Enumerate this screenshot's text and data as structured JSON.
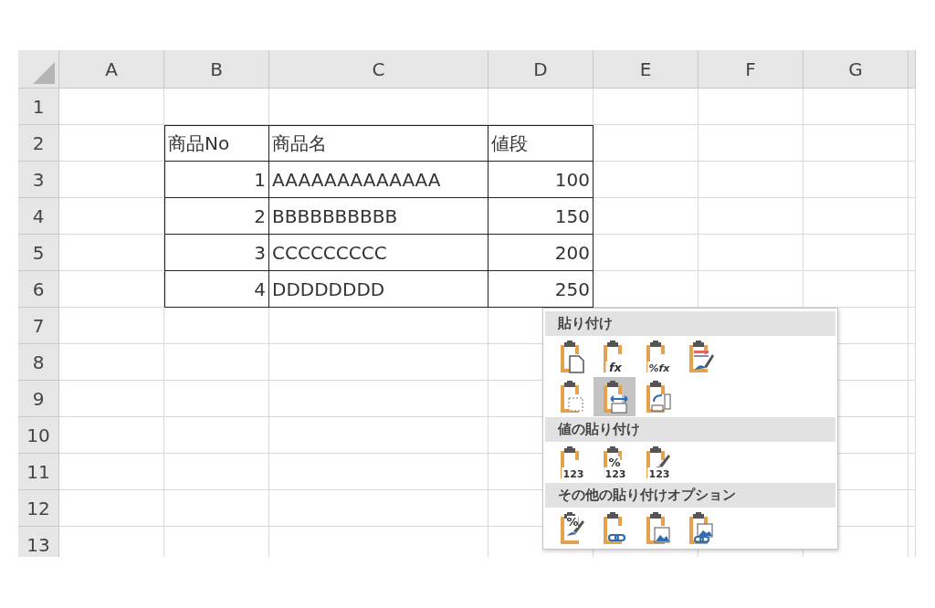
{
  "sheet": {
    "column_headers": [
      "A",
      "B",
      "C",
      "D",
      "E",
      "F",
      "G"
    ],
    "row_headers": [
      "1",
      "2",
      "3",
      "4",
      "5",
      "6",
      "7",
      "8",
      "9",
      "10",
      "11",
      "12",
      "13"
    ],
    "table": {
      "header": [
        "商品No",
        "商品名",
        "値段"
      ],
      "rows": [
        [
          "1",
          "AAAAAAAAAAAAA",
          "100"
        ],
        [
          "2",
          "BBBBBBBBBB",
          "150"
        ],
        [
          "3",
          "CCCCCCCCC",
          "200"
        ],
        [
          "4",
          "DDDDDDDD",
          "250"
        ]
      ]
    }
  },
  "paste_menu": {
    "sections": [
      {
        "title": "貼り付け",
        "options": [
          {
            "kind": "paste",
            "selected": false
          },
          {
            "kind": "formula",
            "badge": [
              "fx"
            ],
            "selected": false
          },
          {
            "kind": "formula",
            "badge": [
              "%fx"
            ],
            "selected": false
          },
          {
            "kind": "source-format",
            "selected": false
          },
          {
            "kind": "no-borders",
            "selected": false
          },
          {
            "kind": "column-width",
            "selected": true
          },
          {
            "kind": "transpose",
            "selected": false
          }
        ]
      },
      {
        "title": "値の貼り付け",
        "options": [
          {
            "kind": "values",
            "badge": [
              "123"
            ],
            "selected": false
          },
          {
            "kind": "values",
            "badge": [
              "%",
              "123"
            ],
            "selected": false
          },
          {
            "kind": "values-brush",
            "badge": [
              "123"
            ],
            "selected": false
          }
        ]
      },
      {
        "title": "その他の貼り付けオプション",
        "options": [
          {
            "kind": "formatting",
            "badge": [
              "%"
            ],
            "selected": false
          },
          {
            "kind": "link",
            "selected": false
          },
          {
            "kind": "picture",
            "selected": false
          },
          {
            "kind": "linked-picture",
            "selected": false
          }
        ]
      }
    ]
  }
}
